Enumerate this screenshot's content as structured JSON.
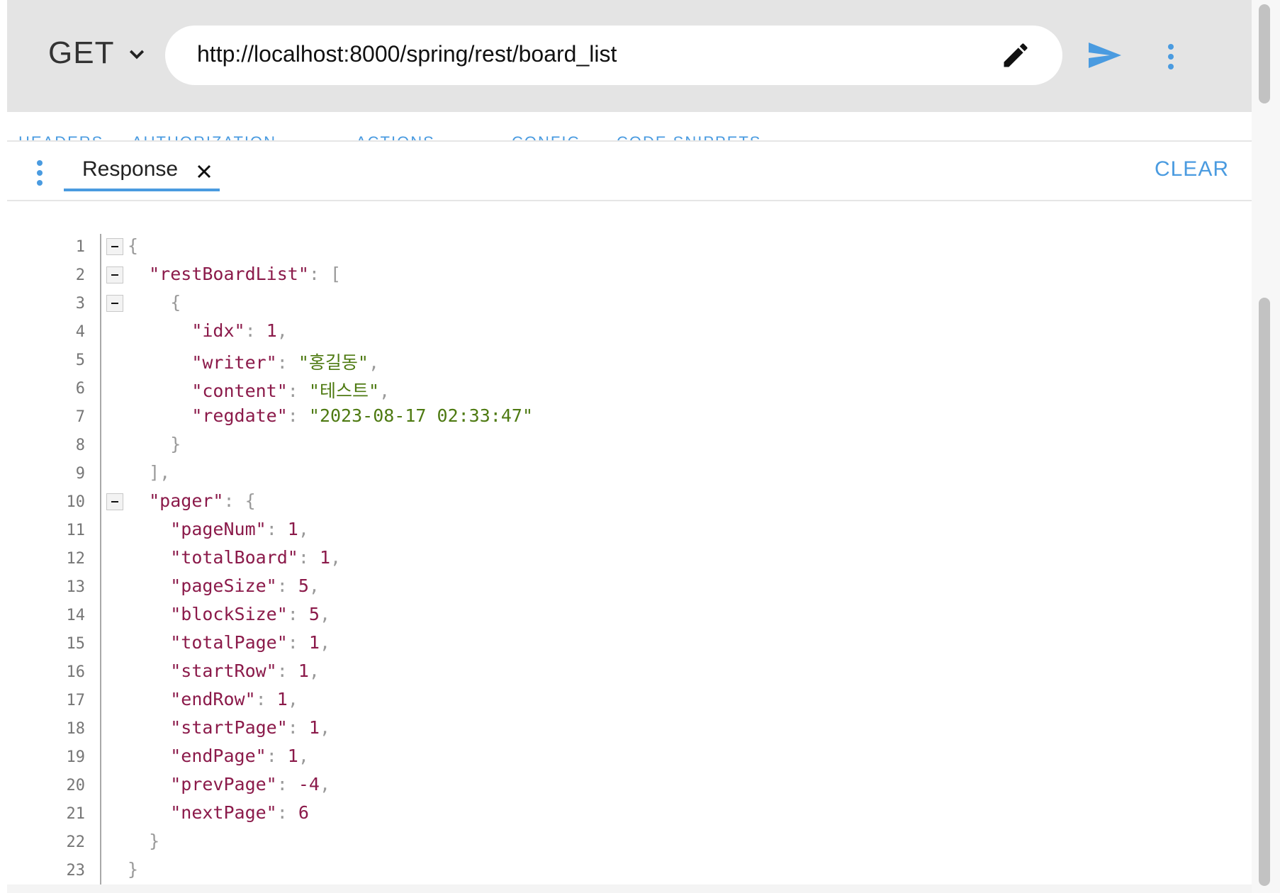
{
  "request": {
    "method": "GET",
    "url": "http://localhost:8000/spring/rest/board_list"
  },
  "icons": {
    "method_dropdown": "chevron-down-icon",
    "edit": "pencil-icon",
    "send": "send-icon",
    "more": "kebab-menu-icon",
    "close": "close-icon"
  },
  "request_tabs": [
    "HEADERS",
    "AUTHORIZATION",
    "ACTIONS",
    "CONFIG",
    "CODE SNIPPETS"
  ],
  "response_panel": {
    "tab_label": "Response",
    "clear_label": "CLEAR"
  },
  "colors": {
    "accent": "#4a9be0",
    "json_key": "#8b1a4a",
    "json_string": "#4e7a12",
    "json_number": "#8b1a4a"
  },
  "response_json": {
    "restBoardList": [
      {
        "idx": "1",
        "writer": "홍길동",
        "content": "테스트",
        "regdate": "2023-08-17 02:33:47"
      }
    ],
    "pager": {
      "pageNum": "1",
      "totalBoard": "1",
      "pageSize": "5",
      "blockSize": "5",
      "totalPage": "1",
      "startRow": "1",
      "endRow": "1",
      "startPage": "1",
      "endPage": "1",
      "prevPage": "-4",
      "nextPage": "6"
    }
  },
  "line_numbers": [
    "1",
    "2",
    "3",
    "4",
    "5",
    "6",
    "7",
    "8",
    "9",
    "10",
    "11",
    "12",
    "13",
    "14",
    "15",
    "16",
    "17",
    "18",
    "19",
    "20",
    "21",
    "22",
    "23"
  ]
}
